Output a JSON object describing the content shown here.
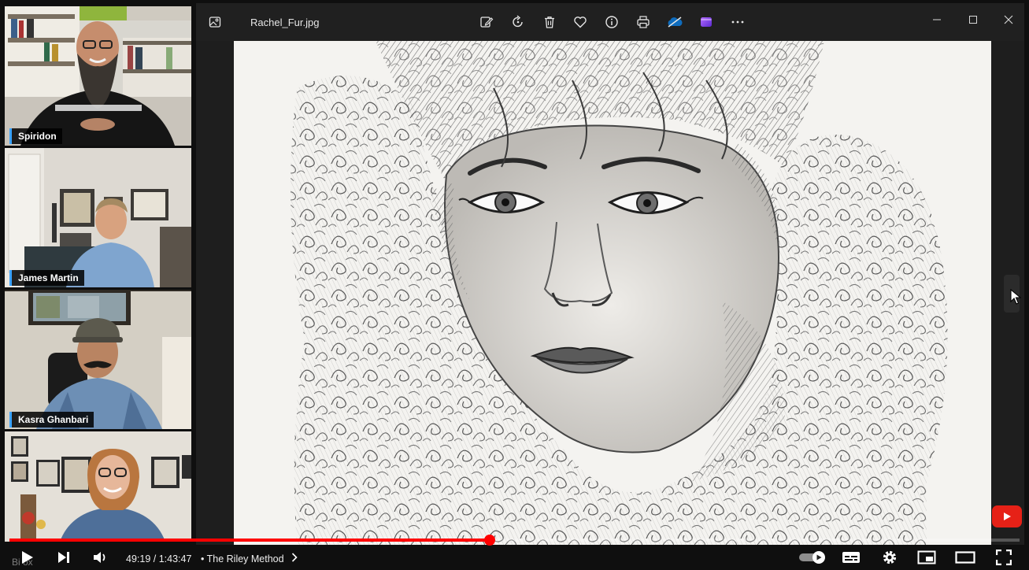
{
  "participants": [
    {
      "name": "Spiridon"
    },
    {
      "name": "James Martin"
    },
    {
      "name": "Kasra Ghanbari"
    },
    {
      "name": ""
    }
  ],
  "viewer": {
    "filename": "Rachel_Fur.jpg",
    "toolbar_icons": [
      "edit-icon",
      "rotate-icon",
      "delete-icon",
      "favorite-icon",
      "info-icon",
      "print-icon",
      "onedrive-icon",
      "clipchamp-icon",
      "more-icon"
    ],
    "window_icons": [
      "minimize-icon",
      "maximize-icon",
      "close-icon"
    ]
  },
  "player": {
    "current_time": "49:19",
    "duration": "1:43:47",
    "time_display": "49:19 / 1:43:47",
    "chapter": "The Riley Method",
    "progress": 0.4751,
    "accent_color": "#ff0000",
    "corner_text": "Bi ox"
  }
}
